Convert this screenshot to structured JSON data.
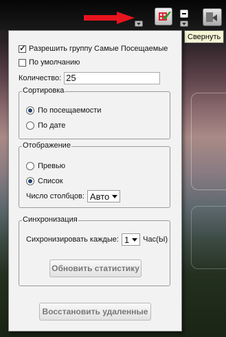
{
  "toolbar": {
    "tooltip": "Свернуть"
  },
  "options": {
    "enable_group_label": "Разрешить группу Самые Посещаемые",
    "enable_group_checked": true,
    "default_label": "По умолчанию",
    "default_checked": false,
    "count_label": "Количество:",
    "count_value": "25"
  },
  "sorting": {
    "legend": "Сортировка",
    "by_visits_label": "По посещаемости",
    "by_date_label": "По дате",
    "selected": "by_visits"
  },
  "display": {
    "legend": "Отображение",
    "preview_label": "Превью",
    "list_label": "Список",
    "selected": "list",
    "columns_label": "Число столбцов:",
    "columns_value": "Авто"
  },
  "sync": {
    "legend": "Синхронизация",
    "every_label": "Сихронизировать каждые:",
    "every_value": "1",
    "unit_label": "Час(Ы)",
    "refresh_button": "Обновить статистику"
  },
  "restore_button": "Восстановить удаленные",
  "colors": {
    "panel_bg": "#f2f2f2",
    "arrow_red": "#e8141e",
    "tooltip_bg": "#f5f5d5"
  }
}
